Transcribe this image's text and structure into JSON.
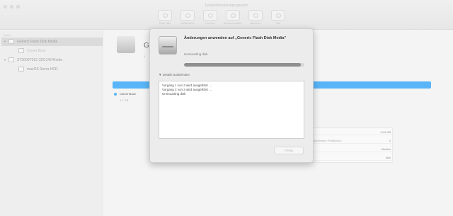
{
  "window": {
    "title": "Festplattendienstprogramm"
  },
  "toolbar": {
    "buttons": [
      {
        "label": "Erste Hilfe",
        "icon": "first-aid-icon"
      },
      {
        "label": "Partitionieren",
        "icon": "partition-icon"
      },
      {
        "label": "Löschen",
        "icon": "erase-icon"
      },
      {
        "label": "Wiederherstellen",
        "icon": "restore-icon"
      },
      {
        "label": "Aktivieren",
        "icon": "mount-icon"
      },
      {
        "label": "Info",
        "icon": "info-icon"
      }
    ]
  },
  "sidebar": {
    "header": "Intern",
    "items": [
      {
        "label": "Generic Flash Disk Media",
        "icon": "disk-icon",
        "selected": true
      },
      {
        "label": "Clover Boot",
        "icon": "volume-icon"
      },
      {
        "label": "ST3000T012-1DC142 Media",
        "icon": "disk-icon"
      },
      {
        "label": "macOS Sierra HDD",
        "icon": "volume-icon"
      }
    ]
  },
  "main": {
    "title": "G",
    "subtitle": "4",
    "usage_color": "#35a5f6",
    "legend_name": "Clover Boot",
    "legend_size": "3,7 GB",
    "info_rows": [
      {
        "key": "",
        "value": "4,04 GB"
      },
      {
        "key": "rgeordneten Partitionen:",
        "value": "2"
      },
      {
        "key": "",
        "value": "Medien"
      },
      {
        "key": "",
        "value": "disk"
      }
    ]
  },
  "dialog": {
    "title": "Änderungen anwenden auf „Generic Flash Disk Media\"",
    "status": "Unmounting disk",
    "progress": 0.97,
    "details_label": "Details ausblenden",
    "log_lines": [
      "Vorgang 1 von 3 wird ausgeführt …",
      "Vorgang 2 von 3 wird ausgeführt …",
      "Unmounting disk"
    ],
    "done_label": "Fertig"
  },
  "colors": {
    "accent": "#35a5f6"
  }
}
